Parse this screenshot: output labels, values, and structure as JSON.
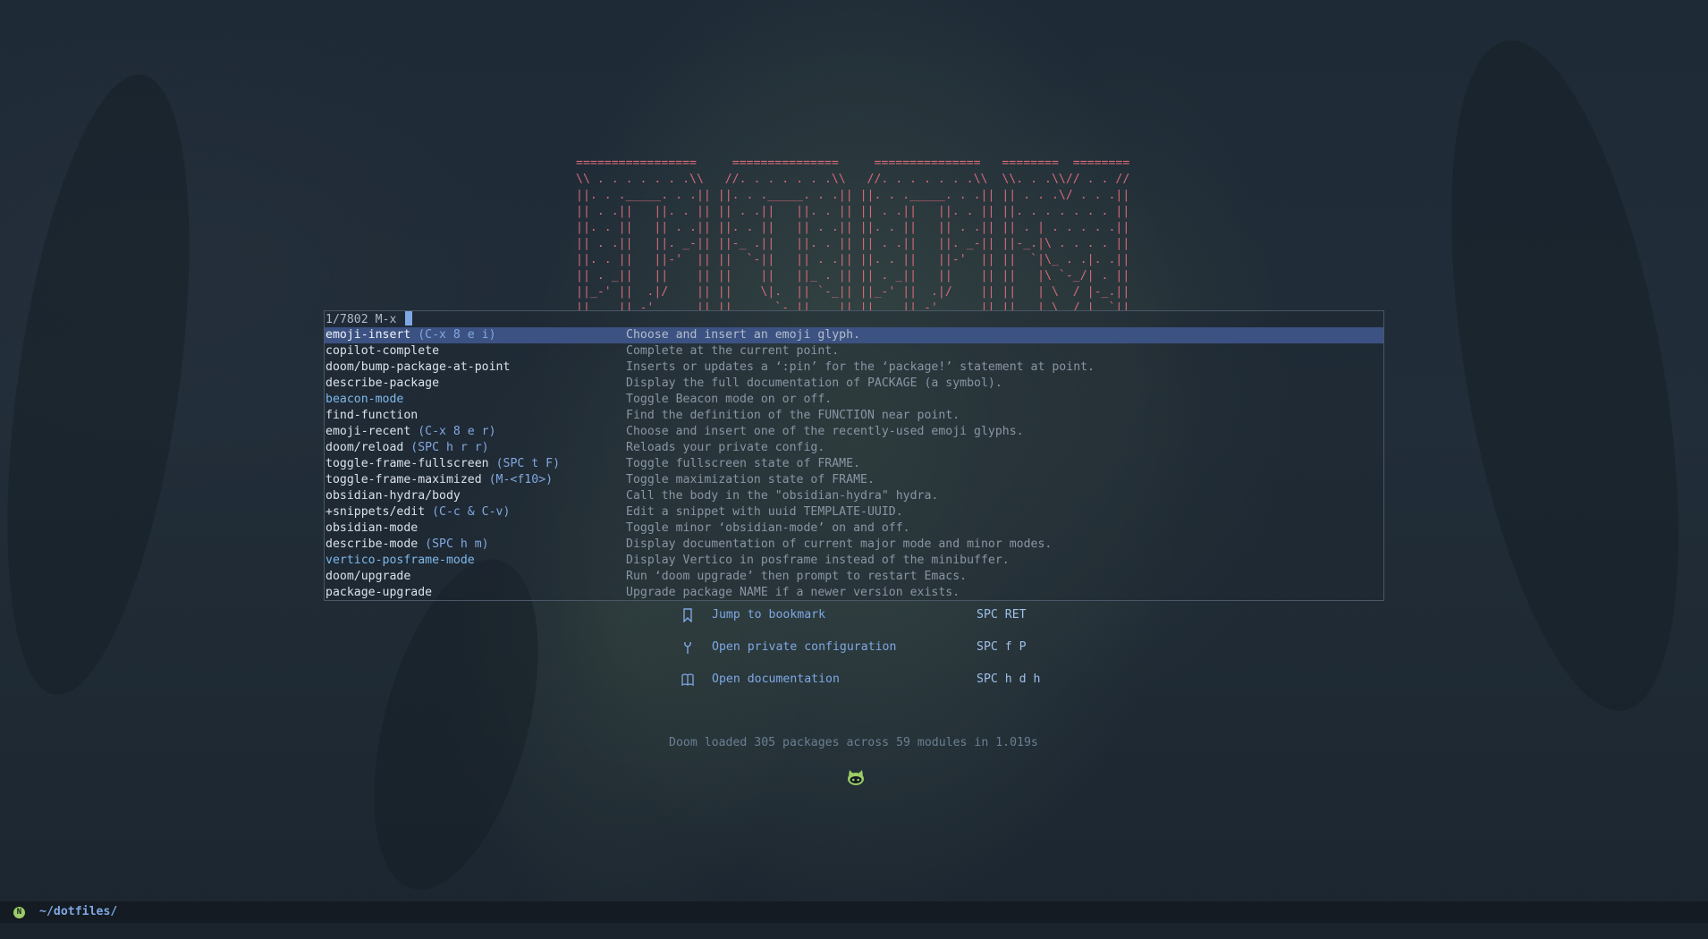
{
  "banner": {
    "lines": [
      "=================     ===============     ===============   ========  ========",
      "\\\\ . . . . . . .\\\\   //. . . . . . .\\\\   //. . . . . . .\\\\  \\\\. . .\\\\// . . //",
      "||. . ._____. . .|| ||. . ._____. . .|| ||. . ._____. . .|| || . . .\\/ . . .||",
      "|| . .||   ||. . || || . .||   ||. . || || . .||   ||. . || ||. . . . . . . ||",
      "||. . ||   || . .|| ||. . ||   || . .|| ||. . ||   || . .|| || . | . . . . .||",
      "|| . .||   ||. _-|| ||-_ .||   ||. . || || . .||   ||. _-|| ||-_.|\\ . . . . ||",
      "||. . ||   ||-'  || ||  `-||   || . .|| ||. . ||   ||-'  || ||  `|\\_ . .|. .||",
      "|| . _||   ||    || ||    ||   ||_ . || || . _||   ||    || ||   |\\ `-_/| . ||",
      "||_-' ||  .|/    || ||    \\|.  || `-_|| ||_-' ||  .|/    || ||   | \\  / |-_.||",
      "||    ||_-'      || ||      `-_||    || ||    ||_-'      || ||   | \\  / |  `||"
    ]
  },
  "minibuffer": {
    "count": "1/7802",
    "prompt": "M-x"
  },
  "candidates": [
    {
      "command": "emoji-insert",
      "key": " (C-x 8 e i)",
      "description": "Choose and insert an emoji glyph.",
      "selected": true,
      "link": false
    },
    {
      "command": "copilot-complete",
      "key": "",
      "description": "Complete at the current point.",
      "selected": false,
      "link": false
    },
    {
      "command": "doom/bump-package-at-point",
      "key": "",
      "description": "Inserts or updates a ‘:pin’ for the ‘package!’ statement at point.",
      "selected": false,
      "link": false
    },
    {
      "command": "describe-package",
      "key": "",
      "description": "Display the full documentation of PACKAGE (a symbol).",
      "selected": false,
      "link": false
    },
    {
      "command": "beacon-mode",
      "key": "",
      "description": "Toggle Beacon mode on or off.",
      "selected": false,
      "link": true
    },
    {
      "command": "find-function",
      "key": "",
      "description": "Find the definition of the FUNCTION near point.",
      "selected": false,
      "link": false
    },
    {
      "command": "emoji-recent",
      "key": " (C-x 8 e r)",
      "description": "Choose and insert one of the recently-used emoji glyphs.",
      "selected": false,
      "link": false
    },
    {
      "command": "doom/reload",
      "key": " (SPC h r r)",
      "description": "Reloads your private config.",
      "selected": false,
      "link": false
    },
    {
      "command": "toggle-frame-fullscreen",
      "key": " (SPC t F)",
      "description": "Toggle fullscreen state of FRAME.",
      "selected": false,
      "link": false
    },
    {
      "command": "toggle-frame-maximized",
      "key": " (M-<f10>)",
      "description": "Toggle maximization state of FRAME.",
      "selected": false,
      "link": false
    },
    {
      "command": "obsidian-hydra/body",
      "key": "",
      "description": "Call the body in the \"obsidian-hydra\" hydra.",
      "selected": false,
      "link": false
    },
    {
      "command": "+snippets/edit",
      "key": " (C-c & C-v)",
      "description": "Edit a snippet with uuid TEMPLATE-UUID.",
      "selected": false,
      "link": false
    },
    {
      "command": "obsidian-mode",
      "key": "",
      "description": "Toggle minor ‘obsidian-mode’ on and off.",
      "selected": false,
      "link": false
    },
    {
      "command": "describe-mode",
      "key": " (SPC h m)",
      "description": "Display documentation of current major mode and minor modes.",
      "selected": false,
      "link": false
    },
    {
      "command": "vertico-posframe-mode",
      "key": "",
      "description": "Display Vertico in posframe instead of the minibuffer.",
      "selected": false,
      "link": true
    },
    {
      "command": "doom/upgrade",
      "key": "",
      "description": "Run ‘doom upgrade’ then prompt to restart Emacs.",
      "selected": false,
      "link": false
    },
    {
      "command": "package-upgrade",
      "key": "",
      "description": "Upgrade package NAME if a newer version exists.",
      "selected": false,
      "link": false
    }
  ],
  "dashboard": {
    "menu": [
      {
        "label": "Jump to bookmark",
        "key": "SPC RET",
        "icon": "bookmark-icon"
      },
      {
        "label": "Open private configuration",
        "key": "SPC f P",
        "icon": "tools-icon"
      },
      {
        "label": "Open documentation",
        "key": "SPC h d h",
        "icon": "book-icon"
      }
    ],
    "loaded": "Doom loaded 305 packages across 59 modules in 1.019s",
    "footer_icon": "github-octocat-icon"
  },
  "modeline": {
    "badge": "N",
    "path": "~/dotfiles/"
  },
  "colors": {
    "banner": "#d46a78",
    "selection": "#3c5282",
    "accent": "#7fa7e4",
    "badge": "#9ccc65"
  }
}
